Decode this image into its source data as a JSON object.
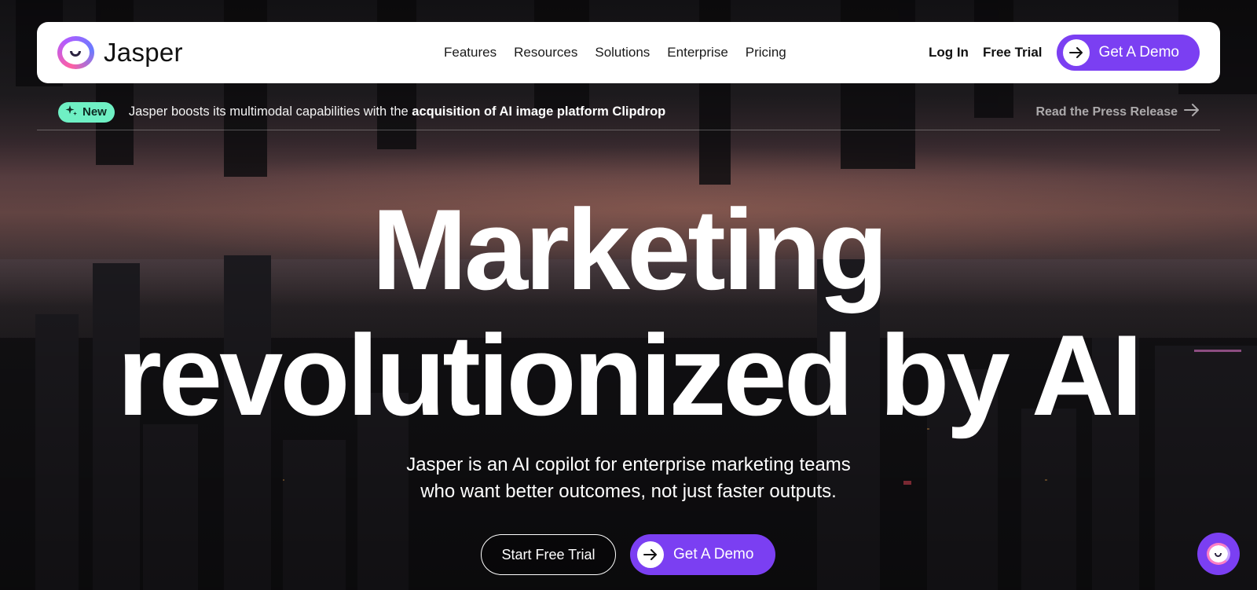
{
  "brand": {
    "name": "Jasper"
  },
  "nav": {
    "links": [
      "Features",
      "Resources",
      "Solutions",
      "Enterprise",
      "Pricing"
    ],
    "login": "Log In",
    "free_trial": "Free Trial",
    "demo": "Get A Demo"
  },
  "announcement": {
    "badge": "New",
    "text": "Jasper boosts its multimodal capabilities with the ",
    "text_bold": "acquisition of AI image platform Clipdrop",
    "link": "Read the Press Release"
  },
  "hero": {
    "line1": "Marketing",
    "line2": "revolutionized by AI",
    "sub1": "Jasper is an AI copilot for enterprise marketing teams",
    "sub2": "who want better outcomes, not just faster outputs.",
    "cta_trial": "Start Free Trial",
    "cta_demo": "Get A Demo"
  },
  "colors": {
    "accent": "#7b3ff2",
    "badge": "#6ff0c4"
  },
  "icons": [
    "arrow-right-icon",
    "sparkle-icon",
    "chat-icon",
    "jasper-logo-icon"
  ]
}
